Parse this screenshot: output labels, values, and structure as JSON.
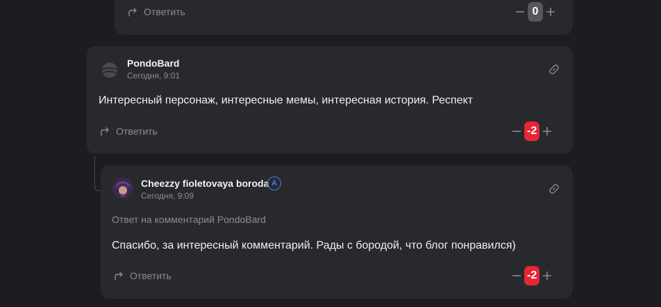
{
  "reply_label": "Ответить",
  "comments": [
    {
      "score": "0",
      "score_state": "neutral"
    },
    {
      "author": "PondoBard",
      "time": "Сегодня, 9:01",
      "text": "Интересный персонаж, интересные мемы, интересная история. Респект",
      "score": "-2",
      "score_state": "negative"
    },
    {
      "author": "Cheezzy fioletovaya boroda",
      "author_badge": "A",
      "time": "Сегодня, 9:09",
      "reply_to": "Ответ на комментарий PondoBard",
      "text": "Спасибо, за интересный комментарий. Рады с бородой, что блог понравился)",
      "score": "-2",
      "score_state": "negative"
    }
  ],
  "colors": {
    "background": "#1c1d20",
    "card": "#28292d",
    "negative_score": "#e52733",
    "neutral_score": "#56585d",
    "author_badge": "#3d7cf2"
  }
}
